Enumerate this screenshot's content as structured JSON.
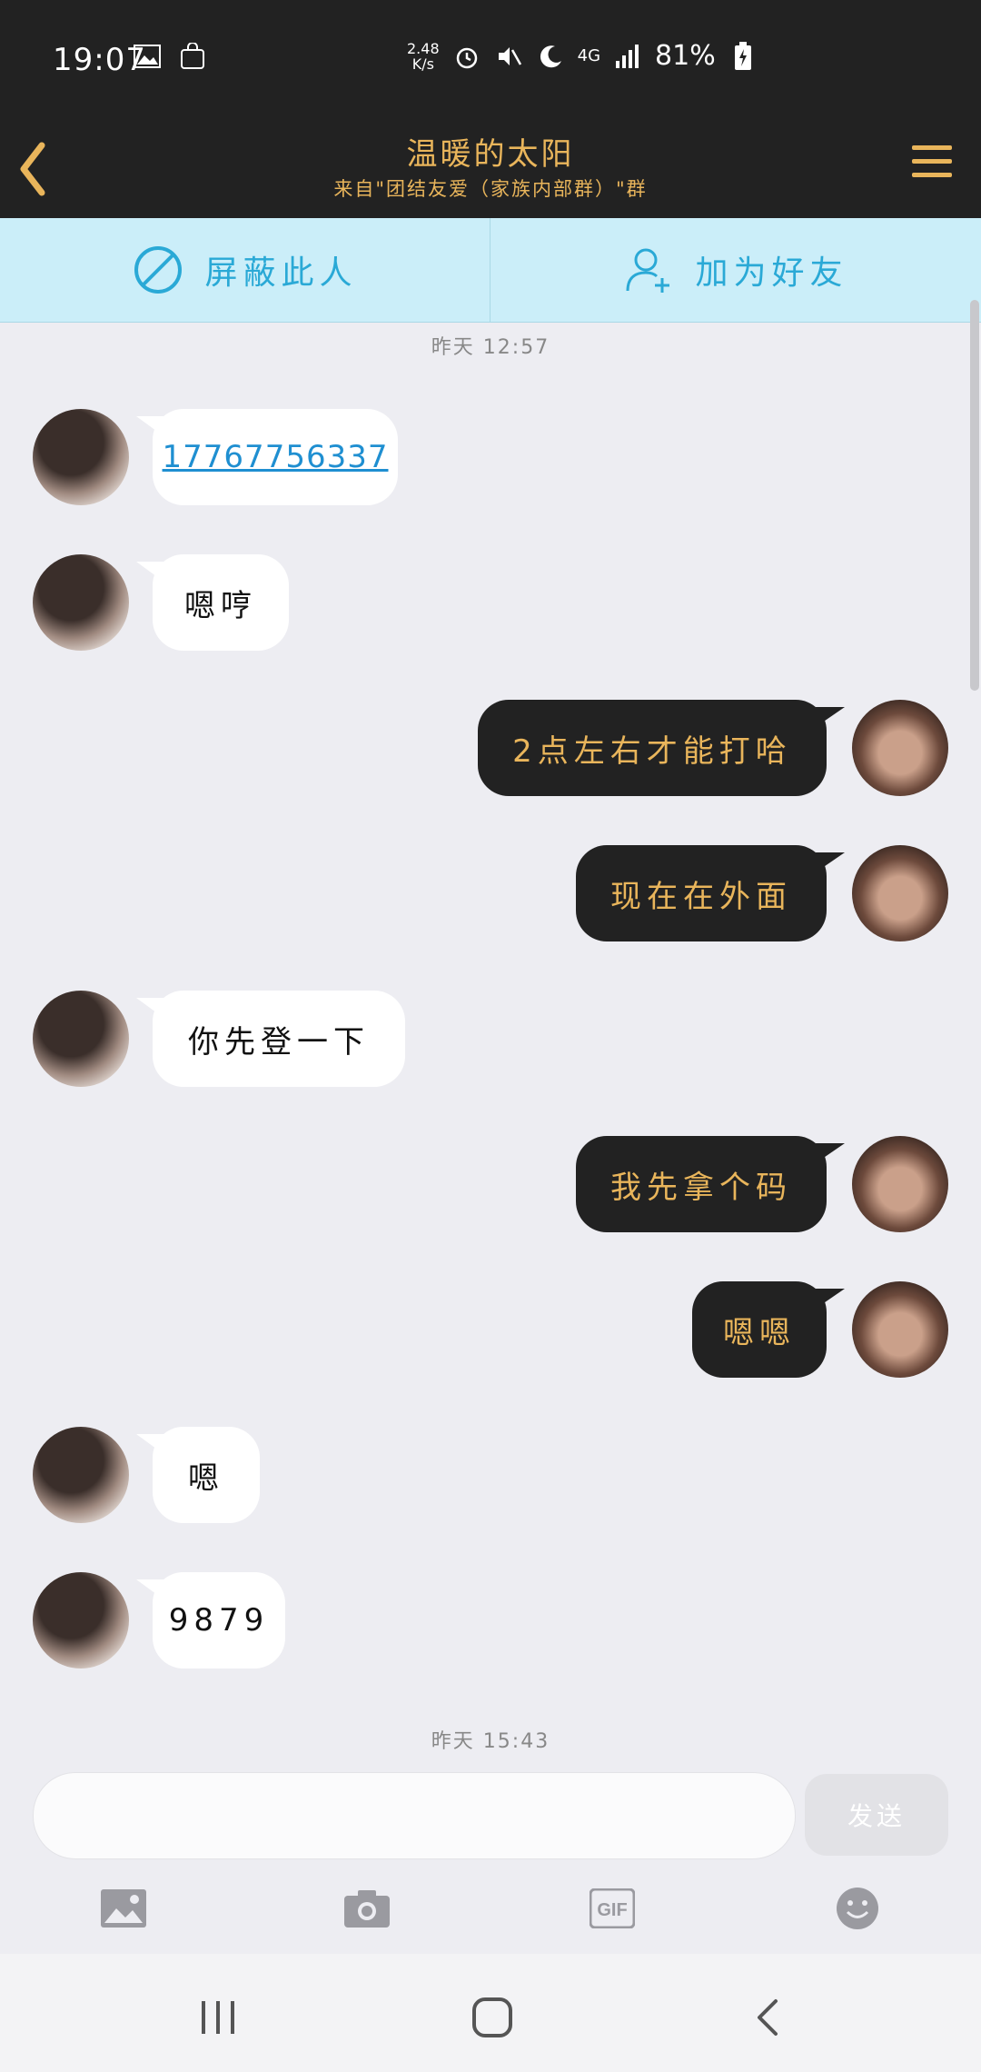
{
  "status_bar": {
    "time": "19:07",
    "network_speed_top": "2.48",
    "network_speed_bottom": "K/s",
    "network_type": "4G",
    "battery": "81%"
  },
  "header": {
    "title": "温暖的太阳",
    "subtitle": "来自\"团结友爱（家族内部群）\"群"
  },
  "actions": {
    "block_label": "屏蔽此人",
    "add_friend_label": "加为好友"
  },
  "timestamps": [
    "昨天 12:57",
    "昨天 15:43"
  ],
  "messages": [
    {
      "side": "them",
      "text": "17767756337",
      "link": true
    },
    {
      "side": "them",
      "text": "嗯哼"
    },
    {
      "side": "me",
      "text": "2点左右才能打哈"
    },
    {
      "side": "me",
      "text": "现在在外面"
    },
    {
      "side": "them",
      "text": "你先登一下"
    },
    {
      "side": "me",
      "text": "我先拿个码"
    },
    {
      "side": "me",
      "text": "嗯嗯"
    },
    {
      "side": "them",
      "text": "嗯"
    },
    {
      "side": "them",
      "text": "9879"
    }
  ],
  "composer": {
    "placeholder": "",
    "send_label": "发送"
  },
  "toolbar": {
    "gif_label": "GIF"
  },
  "icons": {
    "image": "image-icon",
    "camera": "camera-icon",
    "gif": "gif-icon",
    "emoji": "emoji-icon"
  },
  "colors": {
    "accent_gold": "#e9b55b",
    "header_bg": "#222222",
    "action_bar_bg": "#cbeef9",
    "action_text": "#2aa9d6",
    "link": "#1f8fd1"
  }
}
